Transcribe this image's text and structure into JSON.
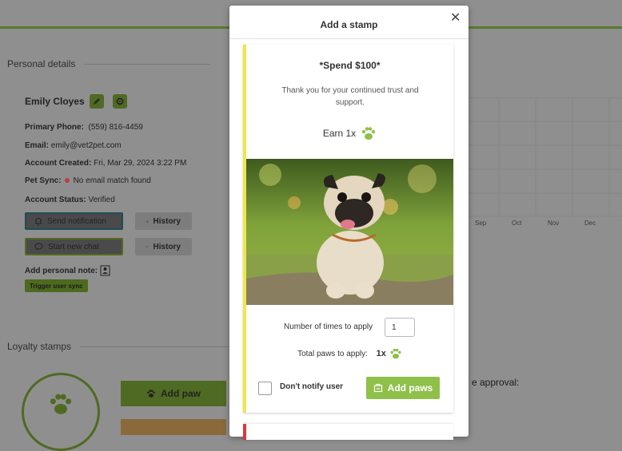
{
  "background": {
    "personal_details_title": "Personal details",
    "name": "Emily Cloyes",
    "primary_phone_label": "Primary Phone:",
    "primary_phone": "(559) 816-4459",
    "email_label": "Email:",
    "email": "emily@vet2pet.com",
    "account_created_label": "Account Created:",
    "account_created": "Fri, Mar 29, 2024 3:22 PM",
    "pet_sync_label": "Pet Sync:",
    "pet_sync": "No email match found",
    "account_status_label": "Account Status:",
    "account_status": "Verified",
    "send_notification": "Send notification",
    "history_1": "History",
    "start_new_chat": "Start new chat",
    "history_2": "History",
    "add_personal_note": "Add personal note:",
    "trigger_user_sync": "Trigger user sync",
    "loyalty_stamps_title": "Loyalty stamps",
    "add_paw": "Add paw",
    "months": [
      "Sep",
      "Oct",
      "Nov",
      "Dec"
    ],
    "approval_text": "e approval:"
  },
  "modal": {
    "title": "Add a stamp",
    "close_icon": "close-icon",
    "card": {
      "title": "*Spend $100*",
      "description": "Thank you for your continued trust and support.",
      "earn_text": "Earn 1x",
      "number_of_times_label": "Number of times to apply",
      "number_of_times_value": "1",
      "total_paws_label": "Total paws to apply:",
      "total_paws_value": "1x",
      "dont_notify_label": "Don't notify user",
      "add_paws_button": "Add paws"
    }
  },
  "colors": {
    "accent_green": "#8ec04a",
    "card_border_yellow": "#f0e64a",
    "card_border_red": "#d53b3b"
  }
}
